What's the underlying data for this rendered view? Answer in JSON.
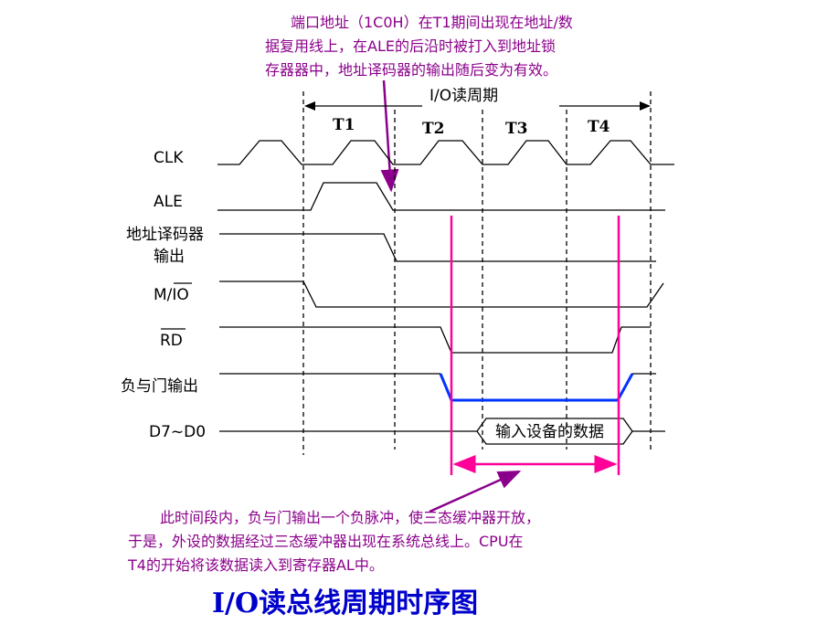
{
  "annotation_top": [
    "端口地址（1C0H）在T1期间出现在地址/数",
    "据复用线上，在ALE的后沿时被打入到地址锁",
    "存器器中，地址译码器的输出随后变为有效。"
  ],
  "cycle_label": "I/O读周期",
  "t_states": [
    "T1",
    "T2",
    "T3",
    "T4"
  ],
  "signals": {
    "clk": "CLK",
    "ale": "ALE",
    "addr_decoder_line1": "地址译码器",
    "addr_decoder_line2": "输出",
    "mio": "M/IO",
    "rd": "RD",
    "nand_out": "负与门输出",
    "data": "D7~D0"
  },
  "data_box_label": "输入设备的数据",
  "annotation_bottom": [
    "此时间段内，负与门输出一个负脉冲，使三态缓冲器开放，",
    "于是，外设的数据经过三态缓冲器出现在系统总线上。CPU在",
    "T4的开始将该数据读入到寄存器AL中。"
  ],
  "title": "I/O读总线周期时序图",
  "colors": {
    "annotation": "#8b008b",
    "marker": "#ff0099",
    "nand_pulse": "#0033ff",
    "title": "#0000cc"
  }
}
